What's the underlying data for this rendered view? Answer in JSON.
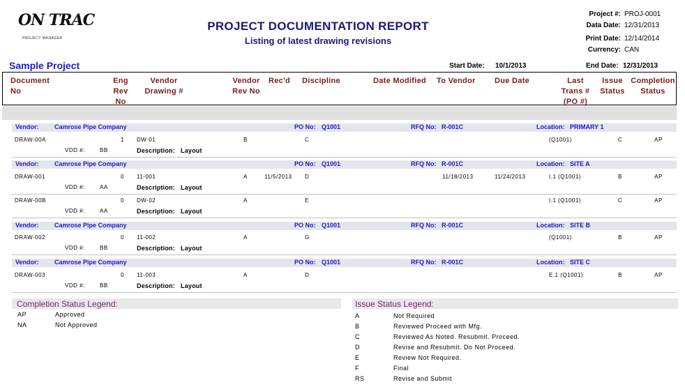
{
  "logo": {
    "text": "ON TRAC",
    "sub": "PROJECT MANAGER"
  },
  "report": {
    "title": "PROJECT DOCUMENTATION REPORT",
    "subtitle": "Listing of latest drawing revisions"
  },
  "meta": {
    "project_label": "Project #:",
    "project_value": "PROJ-0001",
    "data_date_label": "Data Date:",
    "data_date_value": "12/31/2013",
    "print_date_label": "Print Date:",
    "print_date_value": "12/14/2014",
    "currency_label": "Currency:",
    "currency_value": "CAN"
  },
  "project_name": "Sample Project",
  "dates": {
    "start_label": "Start Date:",
    "start_value": "10/1/2013",
    "end_label": "End Date:",
    "end_value": "12/31/2013"
  },
  "columns": {
    "document_no": "Document\nNo",
    "eng_rev_no": "Eng\nRev\nNo",
    "vendor_drawing": "Vendor\nDrawing #",
    "vendor_rev_no": "Vendor\nRev No",
    "recd": "Rec'd",
    "discipline": "Discipline",
    "date_modified": "Date Modified",
    "to_vendor": "To Vendor",
    "due_date": "Due Date",
    "last_trans": "Last\nTrans #\n(PO #)",
    "issue_status": "Issue\nStatus",
    "completion_status": "Completion\nStatus"
  },
  "labels": {
    "vendor": "Vendor:",
    "po_no": "PO No:",
    "rfq_no": "RFQ No:",
    "location": "Location:",
    "vdd": "VDD #:",
    "description": "Description:"
  },
  "groups": [
    {
      "vendor": "Camrose Pipe Company",
      "po": "Q1001",
      "rfq": "R-001C",
      "location": "PRIMARY 1",
      "rows": [
        {
          "doc": "DRAW-00A",
          "eng_rev": "1",
          "vendor_dwg": "DW-01",
          "vendor_rev": "B",
          "recd": "",
          "discipline": "C",
          "to_vendor": "",
          "due_date": "",
          "last_trans": "(Q1001)",
          "issue": "C",
          "completion": "AP",
          "vdd": "BB",
          "description": "Layout"
        }
      ]
    },
    {
      "vendor": "Camrose Pipe Company",
      "po": "Q1001",
      "rfq": "R-001C",
      "location": "SITE A",
      "rows": [
        {
          "doc": "DRAW-001",
          "eng_rev": "0",
          "vendor_dwg": "11-001",
          "vendor_rev": "A",
          "recd": "11/5/2013",
          "discipline": "D",
          "to_vendor": "11/18/2013",
          "due_date": "11/24/2013",
          "last_trans": "I.1 (Q1001)",
          "issue": "B",
          "completion": "AP",
          "vdd": "AA",
          "description": "Layout"
        },
        {
          "doc": "DRAW-00B",
          "eng_rev": "0",
          "vendor_dwg": "DW-02",
          "vendor_rev": "A",
          "recd": "",
          "discipline": "E",
          "to_vendor": "",
          "due_date": "",
          "last_trans": "I.1 (Q1001)",
          "issue": "C",
          "completion": "AP",
          "vdd": "AA",
          "description": "Layout"
        }
      ]
    },
    {
      "vendor": "Camrose Pipe Company",
      "po": "Q1001",
      "rfq": "R-001C",
      "location": "SITE B",
      "rows": [
        {
          "doc": "DRAW-002",
          "eng_rev": "0",
          "vendor_dwg": "11-002",
          "vendor_rev": "A",
          "recd": "",
          "discipline": "G",
          "to_vendor": "",
          "due_date": "",
          "last_trans": "(Q1001)",
          "issue": "B",
          "completion": "AP",
          "vdd": "BB",
          "description": "Layout"
        }
      ]
    },
    {
      "vendor": "Camrose Pipe Company",
      "po": "Q1001",
      "rfq": "R-001C",
      "location": "SITE C",
      "rows": [
        {
          "doc": "DRAW-003",
          "eng_rev": "0",
          "vendor_dwg": "11-003",
          "vendor_rev": "A",
          "recd": "",
          "discipline": "D",
          "to_vendor": "",
          "due_date": "",
          "last_trans": "E.1 (Q1001)",
          "issue": "B",
          "completion": "AP",
          "vdd": "BB",
          "description": "Layout"
        }
      ]
    }
  ],
  "completion_legend": {
    "title": "Completion Status Legend:",
    "items": [
      {
        "code": "AP",
        "text": "Approved"
      },
      {
        "code": "NA",
        "text": "Not Approved"
      }
    ]
  },
  "issue_legend": {
    "title": "Issue Status Legend:",
    "items": [
      {
        "code": "A",
        "text": "Not Required"
      },
      {
        "code": "B",
        "text": "Reviewed Proceed with Mfg."
      },
      {
        "code": "C",
        "text": "Reviewed As Noted. Resubmit. Proceed."
      },
      {
        "code": "D",
        "text": "Revise and Resubmit.  Do Not Proceed."
      },
      {
        "code": "E",
        "text": "Review Not Required."
      },
      {
        "code": "F",
        "text": "Final"
      },
      {
        "code": "RS",
        "text": "Revise and Submit"
      }
    ]
  }
}
